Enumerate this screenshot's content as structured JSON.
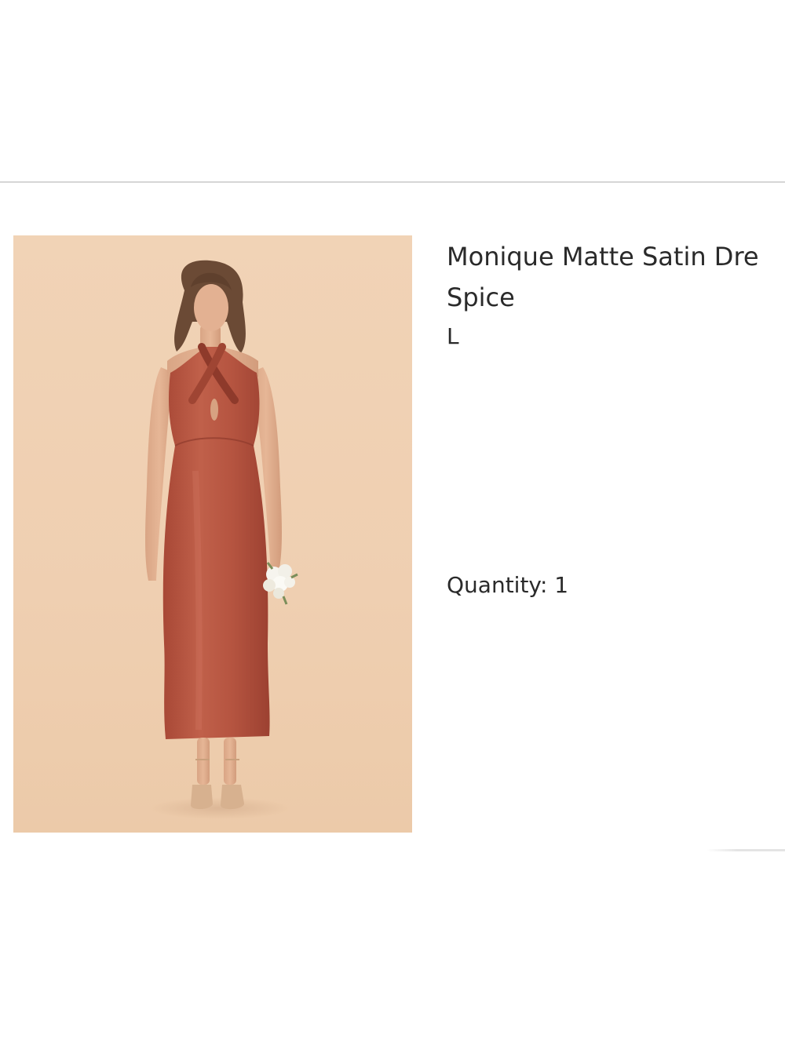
{
  "product": {
    "name": "Monique Matte Satin Dre",
    "color": "Spice",
    "size": "L",
    "quantity_text": "Quantity: 1"
  },
  "colors": {
    "dress": "#b5513f",
    "background": "#f0d1b3"
  }
}
